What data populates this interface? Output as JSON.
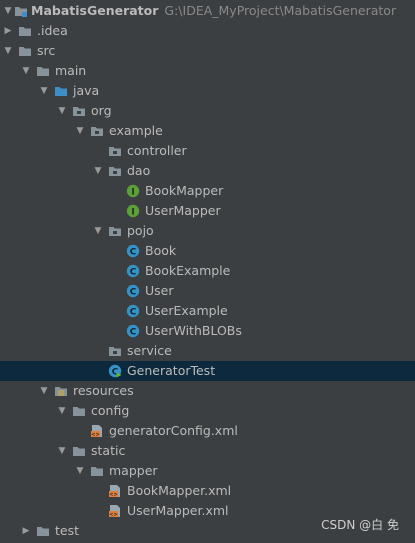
{
  "project": {
    "name": "MabatisGenerator",
    "path": "G:\\IDEA_MyProject\\MabatisGenerator"
  },
  "tree": {
    "idea": ".idea",
    "src": "src",
    "main": "main",
    "java": "java",
    "org": "org",
    "example": "example",
    "controller": "controller",
    "dao": "dao",
    "book_mapper": "BookMapper",
    "user_mapper": "UserMapper",
    "pojo": "pojo",
    "book": "Book",
    "book_example": "BookExample",
    "user": "User",
    "user_example": "UserExample",
    "user_with_blobs": "UserWithBLOBs",
    "service": "service",
    "generator_test": "GeneratorTest",
    "resources": "resources",
    "config": "config",
    "generator_config_xml": "generatorConfig.xml",
    "static": "static",
    "mapper": "mapper",
    "book_mapper_xml": "BookMapper.xml",
    "user_mapper_xml": "UserMapper.xml",
    "test": "test"
  },
  "watermark": "CSDN @白 免",
  "colors": {
    "background": "#3c3f41",
    "selection": "#0d293e",
    "folder": "#87939a",
    "source_folder": "#3d8fc6",
    "resources_folder": "#c9a94a",
    "interface_badge": "#5c9e3a",
    "class_badge": "#3592c4",
    "xml_icon": "#e07f3c"
  }
}
